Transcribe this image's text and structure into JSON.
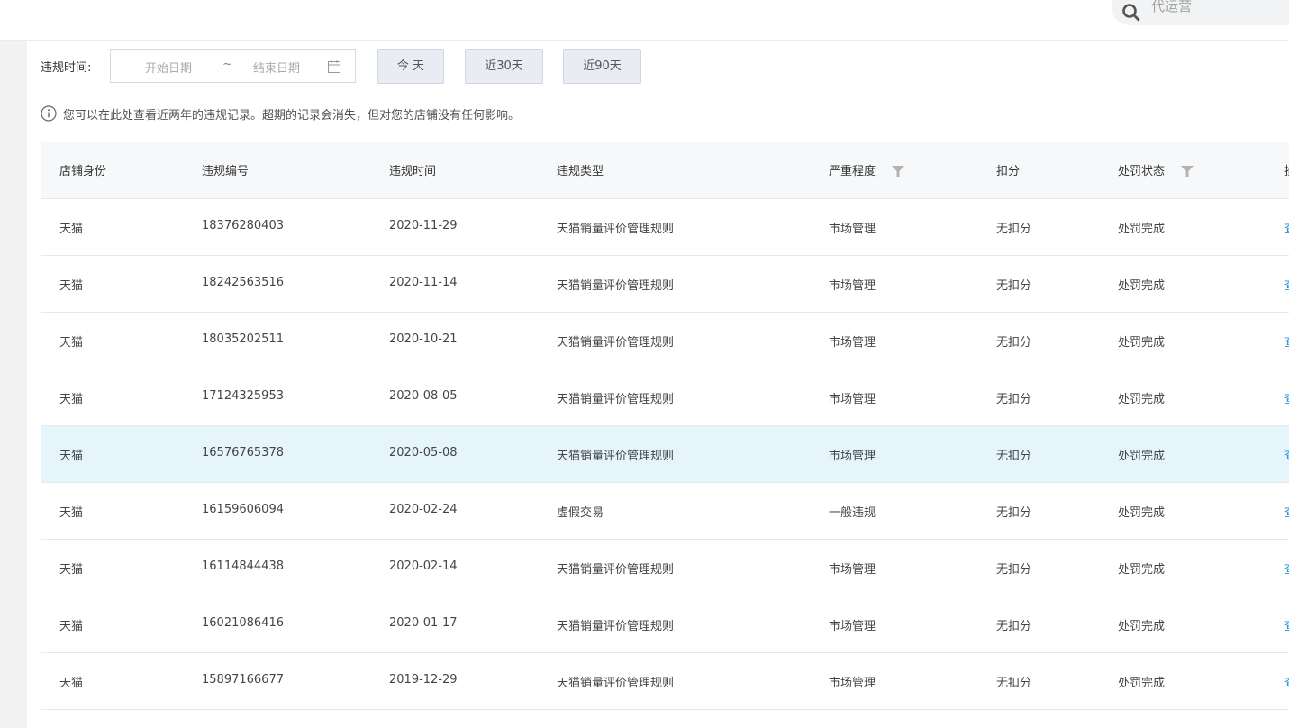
{
  "search": {
    "placeholder": "代运营"
  },
  "filter": {
    "label": "违规时间:",
    "start_placeholder": "开始日期",
    "separator": "~",
    "end_placeholder": "结束日期",
    "quick_buttons": [
      "今 天",
      "近30天",
      "近90天"
    ]
  },
  "notice": "您可以在此处查看近两年的违规记录。超期的记录会消失，但对您的店铺没有任何影响。",
  "table": {
    "columns": [
      "店铺身份",
      "违规编号",
      "违规时间",
      "违规类型",
      "严重程度",
      "扣分",
      "处罚状态",
      "操"
    ],
    "rows": [
      [
        "天猫",
        "18376280403",
        "2020-11-29",
        "天猫销量评价管理规则",
        "市场管理",
        "无扣分",
        "处罚完成",
        "查"
      ],
      [
        "天猫",
        "18242563516",
        "2020-11-14",
        "天猫销量评价管理规则",
        "市场管理",
        "无扣分",
        "处罚完成",
        "查"
      ],
      [
        "天猫",
        "18035202511",
        "2020-10-21",
        "天猫销量评价管理规则",
        "市场管理",
        "无扣分",
        "处罚完成",
        "查"
      ],
      [
        "天猫",
        "17124325953",
        "2020-08-05",
        "天猫销量评价管理规则",
        "市场管理",
        "无扣分",
        "处罚完成",
        "查"
      ],
      [
        "天猫",
        "16576765378",
        "2020-05-08",
        "天猫销量评价管理规则",
        "市场管理",
        "无扣分",
        "处罚完成",
        "查"
      ],
      [
        "天猫",
        "16159606094",
        "2020-02-24",
        "虚假交易",
        "一般违规",
        "无扣分",
        "处罚完成",
        "查"
      ],
      [
        "天猫",
        "16114844438",
        "2020-02-14",
        "天猫销量评价管理规则",
        "市场管理",
        "无扣分",
        "处罚完成",
        "查"
      ],
      [
        "天猫",
        "16021086416",
        "2020-01-17",
        "天猫销量评价管理规则",
        "市场管理",
        "无扣分",
        "处罚完成",
        "查"
      ],
      [
        "天猫",
        "15897166677",
        "2019-12-29",
        "天猫销量评价管理规则",
        "市场管理",
        "无扣分",
        "处罚完成",
        "查"
      ]
    ],
    "highlighted_row": 4
  },
  "colors": {
    "link": "#1a8fdd",
    "highlight_row": "#e6f5fc",
    "header_bg": "#f7f8fa"
  }
}
